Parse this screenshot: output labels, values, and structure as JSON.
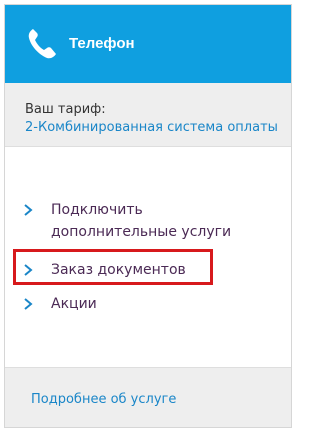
{
  "colors": {
    "header_bg": "#0f9fe0",
    "link": "#1a86c8",
    "menu_text": "#4b2a55",
    "panel_bg": "#eeeeee",
    "highlight": "#d7191c"
  },
  "header": {
    "icon": "phone-icon",
    "title": "Телефон"
  },
  "tariff": {
    "label": "Ваш тариф:",
    "value": "2-Комбинированная система оплаты"
  },
  "menu": {
    "items": [
      {
        "label_line1": "Подключить",
        "label_line2": "дополнительные услуги",
        "icon": "chevron-right-icon"
      },
      {
        "label": "Заказ документов",
        "icon": "chevron-right-icon",
        "highlighted": true
      },
      {
        "label": "Акции",
        "icon": "chevron-right-icon"
      }
    ]
  },
  "footer": {
    "link_label": "Подробнее об услуге"
  }
}
